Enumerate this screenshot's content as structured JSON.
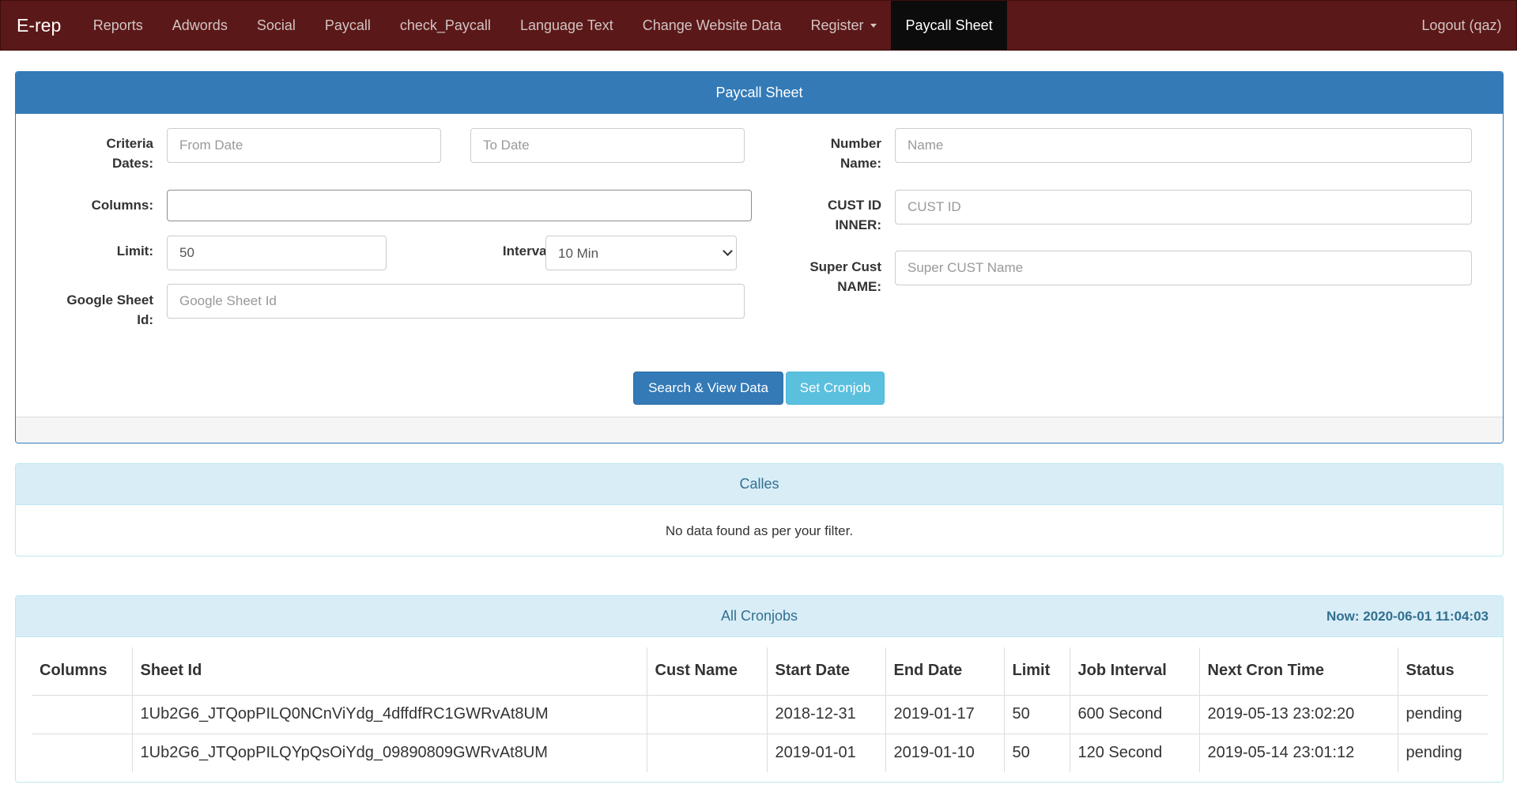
{
  "navbar": {
    "brand": "E-rep",
    "items": [
      "Reports",
      "Adwords",
      "Social",
      "Paycall",
      "check_Paycall",
      "Language Text",
      "Change Website Data"
    ],
    "register": "Register",
    "active": "Paycall Sheet",
    "logout": "Logout (qaz)"
  },
  "form_panel": {
    "title": "Paycall Sheet",
    "criteria_dates_line1": "Criteria",
    "criteria_dates_line2": "Dates:",
    "from_date_placeholder": "From Date",
    "to_date_placeholder": "To Date",
    "columns_label": "Columns:",
    "columns_value": "",
    "limit_label": "Limit:",
    "limit_value": "50",
    "interval_label": "Interval:",
    "interval_value": "10 Min",
    "google_sheet_line1": "Google Sheet",
    "google_sheet_line2": "Id:",
    "google_sheet_placeholder": "Google Sheet Id",
    "number_name_line1": "Number",
    "number_name_line2": "Name:",
    "name_placeholder": "Name",
    "cust_id_line1": "CUST ID",
    "cust_id_line2": "INNER:",
    "cust_id_placeholder": "CUST ID",
    "super_cust_line1": "Super Cust",
    "super_cust_line2": "NAME:",
    "super_cust_placeholder": "Super CUST Name",
    "search_button": "Search & View Data",
    "cronjob_button": "Set Cronjob"
  },
  "calles_panel": {
    "title": "Calles",
    "empty_message": "No data found as per your filter."
  },
  "cronjobs_panel": {
    "title": "All Cronjobs",
    "now": "Now: 2020-06-01 11:04:03",
    "headers": {
      "columns": "Columns",
      "sheet_id": "Sheet Id",
      "cust_name": "Cust Name",
      "start_date": "Start Date",
      "end_date": "End Date",
      "limit": "Limit",
      "job_interval": "Job Interval",
      "next_cron_time": "Next Cron Time",
      "status": "Status"
    },
    "rows": [
      {
        "columns": "",
        "sheet_id": "1Ub2G6_JTQopPILQ0NCnViYdg_4dffdfRC1GWRvAt8UM",
        "cust_name": "",
        "start_date": "2018-12-31",
        "end_date": "2019-01-17",
        "limit": "50",
        "job_interval": "600 Second",
        "next_cron_time": "2019-05-13 23:02:20",
        "status": "pending"
      },
      {
        "columns": "",
        "sheet_id": "1Ub2G6_JTQopPILQYpQsOiYdg_09890809GWRvAt8UM",
        "cust_name": "",
        "start_date": "2019-01-01",
        "end_date": "2019-01-10",
        "limit": "50",
        "job_interval": "120 Second",
        "next_cron_time": "2019-05-14 23:01:12",
        "status": "pending"
      }
    ]
  }
}
